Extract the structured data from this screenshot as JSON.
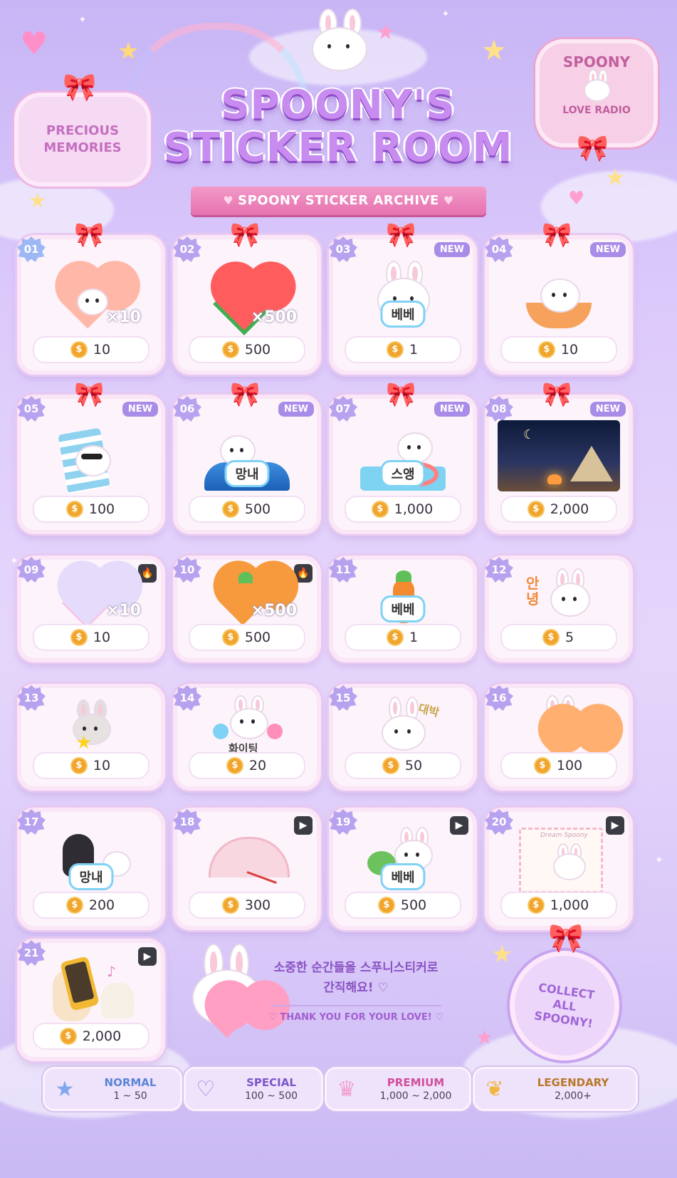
{
  "header": {
    "title_line1": "SPOONY'S",
    "title_line2": "STICKER ROOM",
    "subtitle": "SPOONY STICKER ARCHIVE",
    "badge_left": "PRECIOUS MEMORIES",
    "badge_right_top": "SPOONY",
    "badge_right_bottom": "LOVE RADIO"
  },
  "stickers": [
    {
      "num": "01",
      "price": "10",
      "qty": "×10"
    },
    {
      "num": "02",
      "price": "500",
      "qty": "×500"
    },
    {
      "num": "03",
      "price": "1",
      "tag": "NEW",
      "name": "베베"
    },
    {
      "num": "04",
      "price": "10",
      "tag": "NEW"
    },
    {
      "num": "05",
      "price": "100",
      "tag": "NEW"
    },
    {
      "num": "06",
      "price": "500",
      "tag": "NEW",
      "name": "망내"
    },
    {
      "num": "07",
      "price": "1,000",
      "tag": "NEW",
      "name": "스앵"
    },
    {
      "num": "08",
      "price": "2,000",
      "tag": "NEW"
    },
    {
      "num": "09",
      "price": "10",
      "qty": "×10",
      "icon": "fire-icon"
    },
    {
      "num": "10",
      "price": "500",
      "qty": "×500",
      "icon": "fire-icon"
    },
    {
      "num": "11",
      "price": "1",
      "name": "베베"
    },
    {
      "num": "12",
      "price": "5",
      "art_text": "안녕"
    },
    {
      "num": "13",
      "price": "10"
    },
    {
      "num": "14",
      "price": "20",
      "art_text": "화이팅"
    },
    {
      "num": "15",
      "price": "50",
      "art_text": "대박"
    },
    {
      "num": "16",
      "price": "100"
    },
    {
      "num": "17",
      "price": "200",
      "name": "망내"
    },
    {
      "num": "18",
      "price": "300",
      "icon": "play-icon"
    },
    {
      "num": "19",
      "price": "500",
      "name": "베베",
      "icon": "play-icon"
    },
    {
      "num": "20",
      "price": "1,000",
      "icon": "play-icon",
      "art_text": "Dream Spoony"
    },
    {
      "num": "21",
      "price": "2,000",
      "icon": "play-icon"
    }
  ],
  "footer": {
    "message_line1": "소중한 순간들을 스푸니스티커로",
    "message_line2": "간직해요! ♡",
    "thanks": "♡ THANK YOU FOR YOUR LOVE! ♡",
    "collect": "COLLECT ALL SPOONY!"
  },
  "tiers": [
    {
      "label": "NORMAL",
      "range": "1 ~ 50",
      "color": "#5a86d6",
      "icon": "star-icon"
    },
    {
      "label": "SPECIAL",
      "range": "100 ~ 500",
      "color": "#7a57c9",
      "icon": "heart-icon"
    },
    {
      "label": "PREMIUM",
      "range": "1,000 ~ 2,000",
      "color": "#d0509b",
      "icon": "crown-icon"
    },
    {
      "label": "LEGENDARY",
      "range": "2,000+",
      "color": "#b8782a",
      "icon": "winged-heart-icon"
    }
  ],
  "colors": {
    "background": "#dcc9fb",
    "card": "#fdf3fb",
    "coin": "#f1a52c",
    "new_tag": "#a98ce8",
    "ribbon": "#e672b0"
  }
}
